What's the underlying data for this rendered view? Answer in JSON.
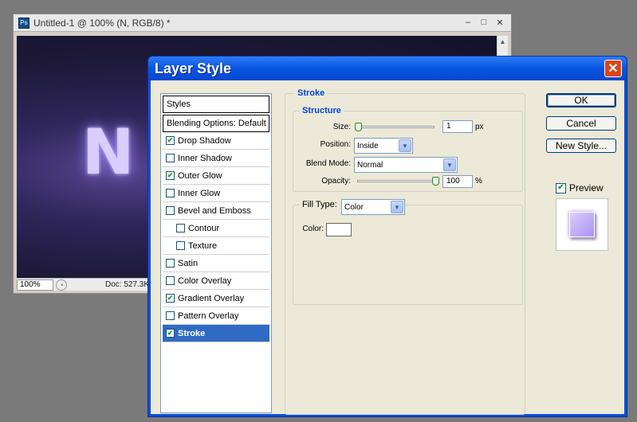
{
  "document": {
    "app_icon": "Ps",
    "title": "Untitled-1 @ 100% (N, RGB/8) *",
    "canvas_letter": "N",
    "zoom": "100%",
    "doc_info": "Doc: 527.3K",
    "controls": {
      "minimize": "–",
      "maximize": "□",
      "close": "✕"
    }
  },
  "dialog": {
    "title": "Layer Style",
    "close_glyph": "✕",
    "styles_header": "Styles",
    "blending_options": "Blending Options: Default",
    "effects": [
      {
        "label": "Drop Shadow",
        "checked": true
      },
      {
        "label": "Inner Shadow",
        "checked": false
      },
      {
        "label": "Outer Glow",
        "checked": true
      },
      {
        "label": "Inner Glow",
        "checked": false
      },
      {
        "label": "Bevel and Emboss",
        "checked": false
      },
      {
        "label": "Contour",
        "checked": false,
        "indent": true
      },
      {
        "label": "Texture",
        "checked": false,
        "indent": true
      },
      {
        "label": "Satin",
        "checked": false
      },
      {
        "label": "Color Overlay",
        "checked": false
      },
      {
        "label": "Gradient Overlay",
        "checked": true
      },
      {
        "label": "Pattern Overlay",
        "checked": false
      },
      {
        "label": "Stroke",
        "checked": true,
        "selected": true
      }
    ],
    "stroke": {
      "group_title": "Stroke",
      "structure_title": "Structure",
      "size_label": "Size:",
      "size_value": "1",
      "size_unit": "px",
      "position_label": "Position:",
      "position_value": "Inside",
      "blend_mode_label": "Blend Mode:",
      "blend_mode_value": "Normal",
      "opacity_label": "Opacity:",
      "opacity_value": "100",
      "opacity_unit": "%",
      "fill_type_label": "Fill Type:",
      "fill_type_value": "Color",
      "color_label": "Color:",
      "stroke_color": "#ffffff"
    },
    "buttons": {
      "ok": "OK",
      "cancel": "Cancel",
      "new_style": "New Style..."
    },
    "preview_label": "Preview",
    "preview_checked": true
  }
}
